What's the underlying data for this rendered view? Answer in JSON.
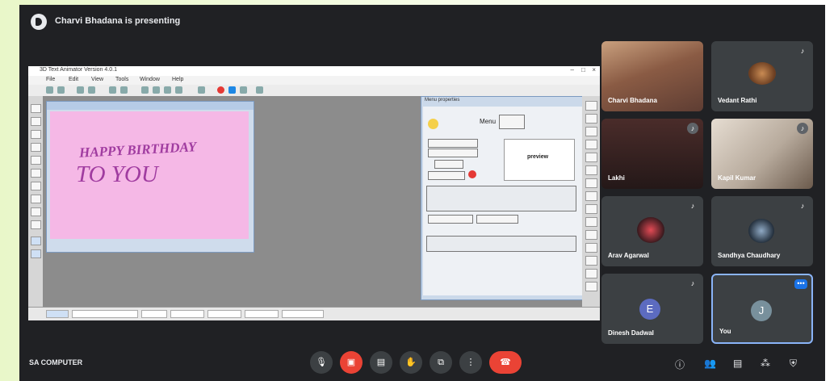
{
  "presenting": {
    "text": "Charvi Bhadana is presenting"
  },
  "app": {
    "title": "3D Text Animator Version 4.0.1",
    "menus": [
      "File",
      "Edit",
      "View",
      "Tools",
      "Window",
      "Help"
    ],
    "canvas_line1": "HAPPY BIRTHDAY",
    "canvas_line2": "TO YOU",
    "dialog_title": "Menu properties",
    "dialog_menu_label": "Menu",
    "preview_label": "preview"
  },
  "participants": [
    {
      "name": "Charvi Bhadana",
      "kind": "video",
      "muted": false
    },
    {
      "name": "Vedant Rathi",
      "kind": "video",
      "muted": true
    },
    {
      "name": "Lakhi",
      "kind": "video",
      "muted": true
    },
    {
      "name": "Kapil Kumar",
      "kind": "video",
      "muted": true
    },
    {
      "name": "Arav Agarwal",
      "kind": "video",
      "muted": true
    },
    {
      "name": "Sandhya Chaudhary",
      "kind": "video",
      "muted": true
    },
    {
      "name": "Dinesh Dadwal",
      "kind": "avatar",
      "initial": "E",
      "color": "#5c6bc0",
      "muted": true
    },
    {
      "name": "You",
      "kind": "avatar",
      "initial": "J",
      "color": "#78909c",
      "muted": false
    }
  ],
  "bottom": {
    "meeting_name": "SA COMPUTER"
  },
  "colors": {
    "hangup": "#ea4335",
    "accent": "#8ab4f8"
  }
}
